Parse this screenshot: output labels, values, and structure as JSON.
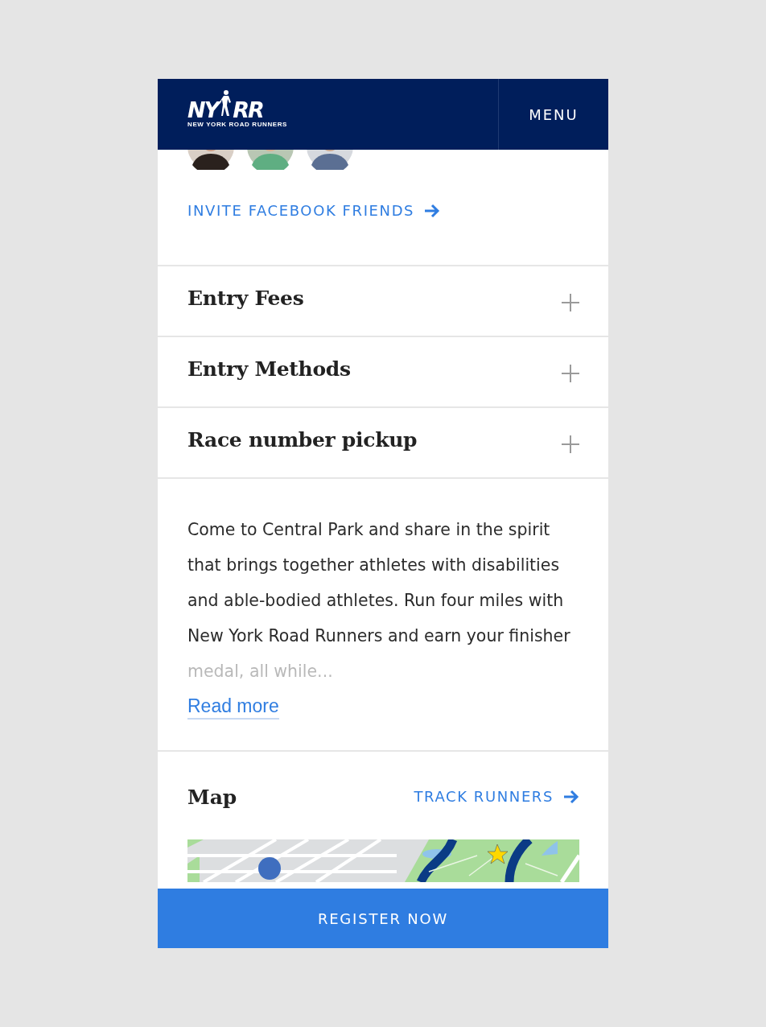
{
  "header": {
    "logo": {
      "left": "NY",
      "right": "RR",
      "tagline": "NEW YORK ROAD RUNNERS"
    },
    "menu": "MENU"
  },
  "invite_link": "INVITE FACEBOOK FRIENDS",
  "sections": [
    {
      "title": "Entry Fees",
      "expanded": false
    },
    {
      "title": "Entry Methods",
      "expanded": false
    },
    {
      "title": "Race number pickup",
      "expanded": false
    }
  ],
  "description": {
    "text": "Come to Central Park and share in the spirit that brings together athletes with disabilities and able-bodied athletes. Run four miles with New York Road Runners and earn your finisher medal, all while...",
    "faded": true,
    "read_more": "Read more"
  },
  "map": {
    "title": "Map",
    "link": "TRACK RUNNERS"
  },
  "register_button": "REGISTER NOW"
}
